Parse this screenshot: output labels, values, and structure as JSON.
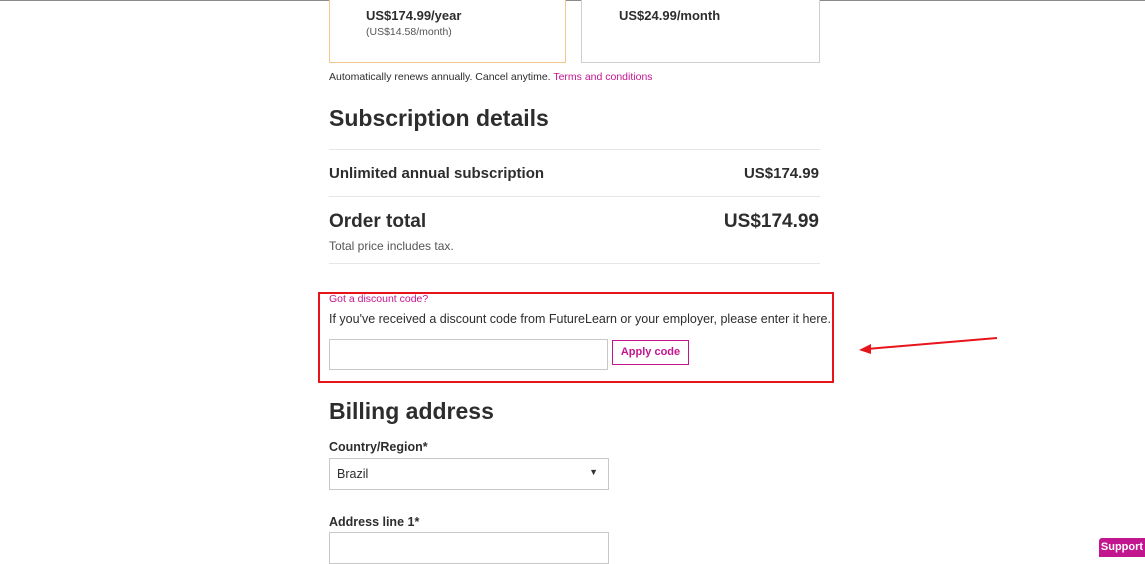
{
  "plans": {
    "annual": {
      "price": "US$174.99/year",
      "sub": "(US$14.58/month)"
    },
    "monthly": {
      "price": "US$24.99/month"
    }
  },
  "renewal": {
    "text": "Automatically renews annually. Cancel anytime.",
    "link": "Terms and conditions"
  },
  "subscription": {
    "heading": "Subscription details",
    "item_label": "Unlimited annual subscription",
    "item_price": "US$174.99",
    "total_label": "Order total",
    "total_price": "US$174.99",
    "total_note": "Total price includes tax."
  },
  "discount": {
    "link": "Got a discount code?",
    "description": "If you've received a discount code from FutureLearn or your employer, please enter it here.",
    "input_value": "",
    "apply_label": "Apply code"
  },
  "billing": {
    "heading": "Billing address",
    "country_label": "Country/Region*",
    "country_value": "Brazil",
    "address_label": "Address line 1*",
    "address_value": ""
  },
  "support": {
    "label": "Support"
  },
  "colors": {
    "accent": "#c2168f",
    "annotation": "#e8141b",
    "annual_border": "#f2c98a"
  },
  "icons": {
    "select_caret": "caret-down-icon",
    "annotation_arrow": "arrow-left-icon"
  }
}
